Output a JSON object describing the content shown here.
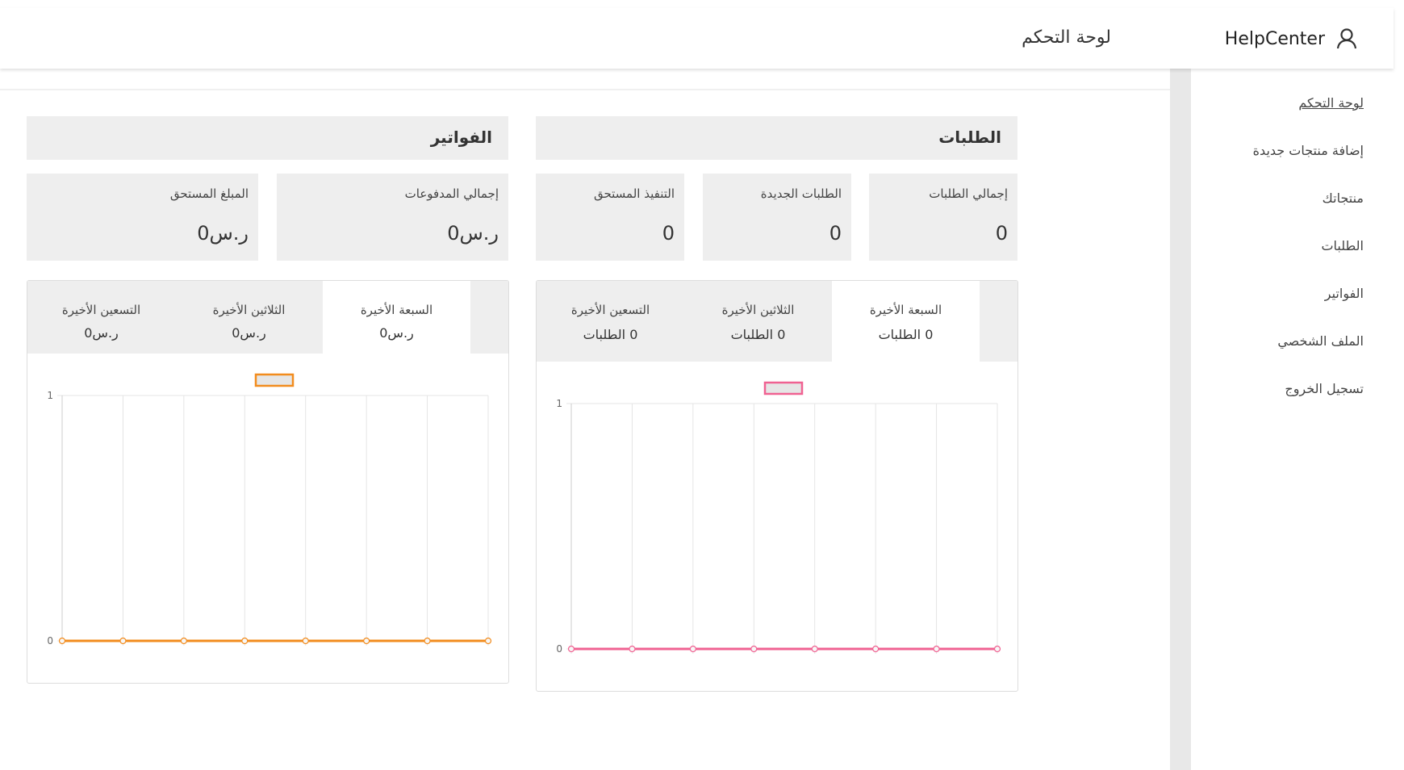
{
  "header": {
    "brand": "HelpCenter",
    "page_title": "لوحة التحكم"
  },
  "sidebar": {
    "items": [
      {
        "label": "لوحة التحكم",
        "active": true
      },
      {
        "label": "إضافة منتجات جديدة"
      },
      {
        "label": "منتجاتك"
      },
      {
        "label": "الطلبات"
      },
      {
        "label": "الفواتير"
      },
      {
        "label": "الملف الشخصي"
      },
      {
        "label": "تسجيل الخروج"
      }
    ]
  },
  "orders": {
    "title": "الطلبات",
    "stats": [
      {
        "label": "إجمالي الطلبات",
        "value": "0"
      },
      {
        "label": "الطلبات الجديدة",
        "value": "0"
      },
      {
        "label": "التنفيذ المستحق",
        "value": "0"
      }
    ],
    "tabs": [
      {
        "label": "السبعة الأخيرة",
        "value": "0 الطلبات"
      },
      {
        "label": "الثلاثين الأخيرة",
        "value": "0 الطلبات"
      },
      {
        "label": "التسعين الأخيرة",
        "value": "0 الطلبات"
      }
    ]
  },
  "invoices": {
    "title": "الفواتير",
    "stats": [
      {
        "label": "إجمالي المدفوعات",
        "value": "ر.س0"
      },
      {
        "label": "المبلغ المستحق",
        "value": "ر.س0"
      }
    ],
    "tabs": [
      {
        "label": "السبعة الأخيرة",
        "value": "ر.س0"
      },
      {
        "label": "الثلاثين الأخيرة",
        "value": "ر.س0"
      },
      {
        "label": "التسعين الأخيرة",
        "value": "ر.س0"
      }
    ]
  },
  "colors": {
    "orders_line": "#f06292",
    "invoices_line": "#f28c1e",
    "panel_bg": "#eeeeee"
  },
  "chart_data": [
    {
      "type": "line",
      "x": [
        "",
        "",
        "",
        "",
        "",
        "",
        "",
        ""
      ],
      "series": [
        {
          "values": [
            0,
            0,
            0,
            0,
            0,
            0,
            0,
            0
          ],
          "color": "#f06292"
        }
      ],
      "ylim": [
        0,
        1
      ],
      "yticks": [
        "0",
        "1"
      ],
      "grid": true,
      "legend": "top"
    },
    {
      "type": "line",
      "x": [
        "",
        "",
        "",
        "",
        "",
        "",
        "",
        ""
      ],
      "series": [
        {
          "values": [
            0,
            0,
            0,
            0,
            0,
            0,
            0,
            0
          ],
          "color": "#f28c1e"
        }
      ],
      "ylim": [
        0,
        1
      ],
      "yticks": [
        "0",
        "1"
      ],
      "grid": true,
      "legend": "top"
    }
  ]
}
